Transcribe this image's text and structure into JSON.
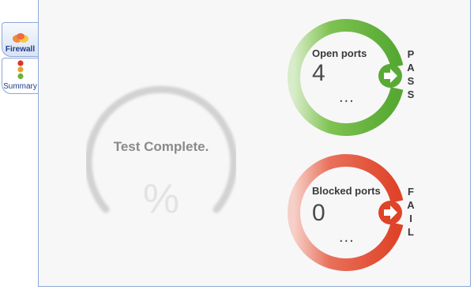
{
  "tabs": [
    {
      "label": "Firewall",
      "icon": "firewall-icon"
    },
    {
      "label": "Summary",
      "icon": "traffic-light-icon"
    }
  ],
  "gauge": {
    "status": "Test Complete.",
    "percent_symbol": "%"
  },
  "open_ports": {
    "label": "Open ports",
    "count": "4",
    "more": "...",
    "verdict": [
      "P",
      "A",
      "S",
      "S"
    ],
    "color": "#5aaa36"
  },
  "blocked_ports": {
    "label": "Blocked ports",
    "count": "0",
    "more": "...",
    "verdict": [
      "F",
      "A",
      "I",
      "L"
    ],
    "color": "#e0462a"
  }
}
